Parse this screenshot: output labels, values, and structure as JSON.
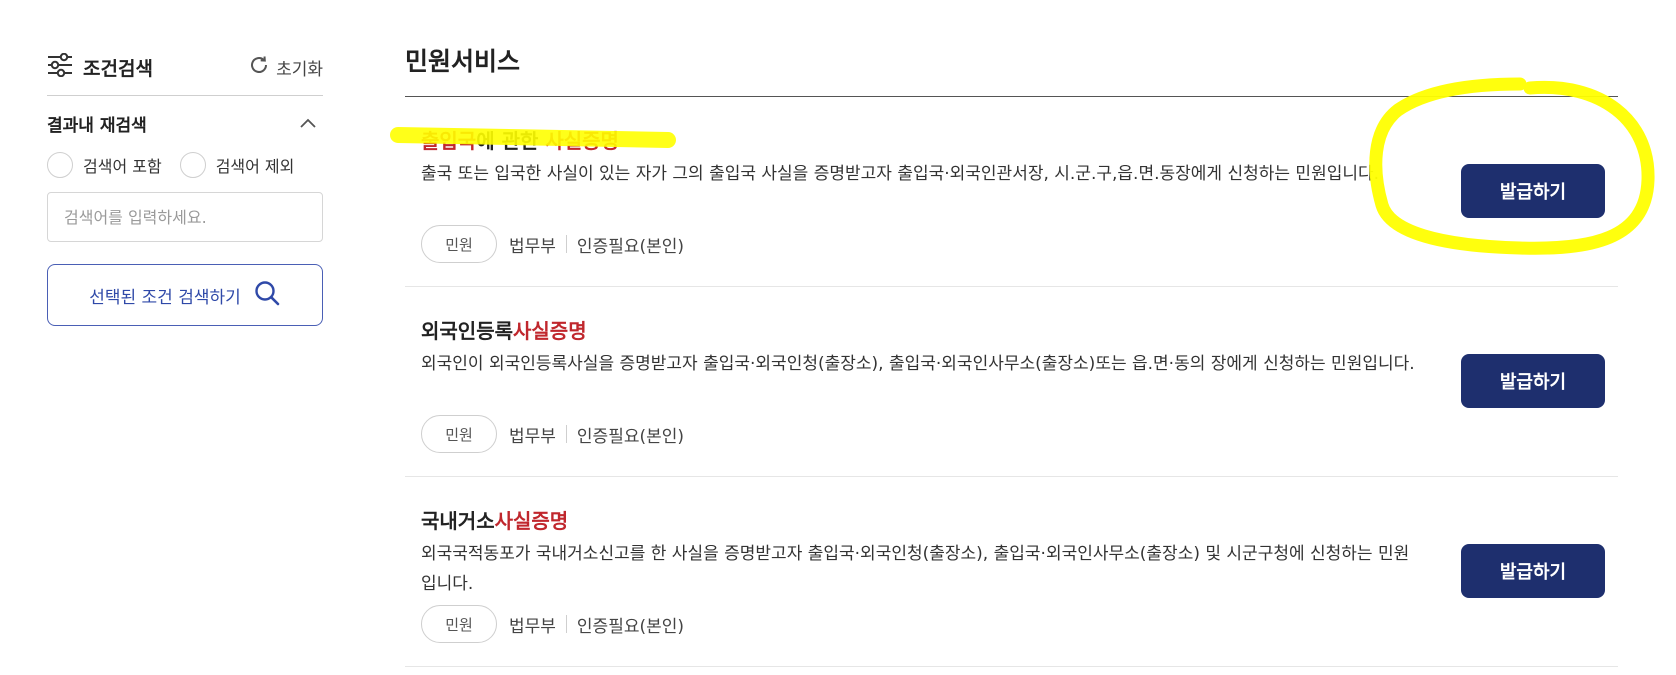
{
  "sidebar": {
    "title": "조건검색",
    "filter_icon": "sliders-icon",
    "reset_label": "초기화",
    "reset_icon": "refresh-icon",
    "refine_title": "결과내 재검색",
    "collapse_icon": "chevron-up-icon",
    "radio_include": "검색어 포함",
    "radio_exclude": "검색어 제외",
    "search_placeholder": "검색어를 입력하세요.",
    "search_value": "",
    "search_button_label": "선택된 조건 검색하기",
    "search_button_icon": "search-icon"
  },
  "main": {
    "title": "민원서비스",
    "items": [
      {
        "title_parts": [
          "출입국",
          "에 관한 ",
          "사실증명"
        ],
        "desc": "출국 또는 입국한 사실이 있는 자가 그의 출입국 사실을 증명받고자 출입국·외국인관서장, 시.군.구,읍.면.동장에게 신청하는 민원입니다.",
        "tag": "민원",
        "org": "법무부",
        "auth": "인증필요(본인)",
        "button": "발급하기"
      },
      {
        "title_parts": [
          "외국인등록",
          "사실증명"
        ],
        "desc": "외국인이 외국인등록사실을 증명받고자 출입국·외국인청(출장소), 출입국·외국인사무소(출장소)또는 읍.면·동의 장에게 신청하는 민원입니다.",
        "tag": "민원",
        "org": "법무부",
        "auth": "인증필요(본인)",
        "button": "발급하기"
      },
      {
        "title_parts": [
          "국내거소",
          "사실증명"
        ],
        "desc": "외국국적동포가 국내거소신고를 한 사실을 증명받고자 출입국·외국인청(출장소), 출입국·외국인사무소(출장소) 및 시군구청에 신청하는 민원입니다.",
        "tag": "민원",
        "org": "법무부",
        "auth": "인증필요(본인)",
        "button": "발급하기"
      }
    ]
  },
  "colors": {
    "accent_red": "#c0272d",
    "button_navy": "#1e2f6e",
    "outline_blue": "#4a5fb5",
    "highlighter_yellow": "#ffff00"
  }
}
